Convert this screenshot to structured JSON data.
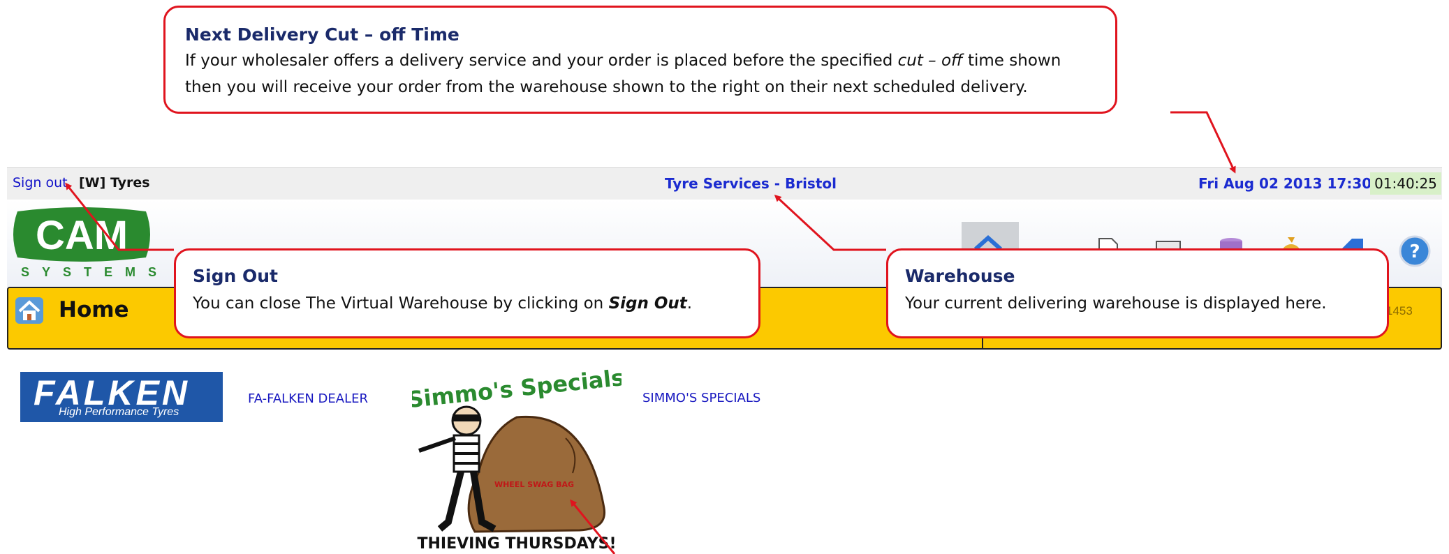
{
  "header": {
    "signout_label": "Sign out",
    "wholesaler_tag": "[W] Tyres",
    "warehouse_name": "Tyre Services - Bristol",
    "datetime": "Fri Aug 02 2013 17:30",
    "cutoff_timer": "01:40:25"
  },
  "logo": {
    "brand": "CAM",
    "sub": "SYSTEMS"
  },
  "toolbar": {
    "icons": [
      "home-icon",
      "globe-icon",
      "document-search-icon",
      "catalogue-icon",
      "database-icon",
      "money-bag-icon",
      "tag-icon",
      "help-icon"
    ]
  },
  "homebar": {
    "title": "Home",
    "right_number_fragment": "1453"
  },
  "content": {
    "falken": {
      "logo_word": "FALKEN",
      "logo_tagline": "High Performance Tyres",
      "link": "FA-FALKEN DEALER"
    },
    "simmo": {
      "image_title": "Simmo's Specials",
      "image_bag_text": "WHEEL SWAG BAG",
      "image_caption": "THIEVING THURSDAYS!",
      "link": "SIMMO'S SPECIALS"
    }
  },
  "callouts": {
    "cutoff": {
      "title": "Next Delivery Cut – off Time",
      "line1_before": "If your wholesaler offers a delivery service and your order is placed before the specified ",
      "line1_em": "cut – off",
      "line1_after": " time shown",
      "line2": "then you will receive your order from the warehouse shown to the right on their next scheduled delivery."
    },
    "signout": {
      "title": "Sign Out",
      "text_before": "You can close The Virtual Warehouse by clicking on ",
      "text_em": "Sign Out",
      "text_after": "."
    },
    "warehouse": {
      "title": "Warehouse",
      "text": "Your current delivering warehouse is displayed here."
    }
  },
  "colors": {
    "callout_border": "#e0141e",
    "homebar": "#fcc900",
    "link": "#1818c0",
    "brand_green": "#2a8a2f",
    "falken_blue": "#1f57a8"
  }
}
